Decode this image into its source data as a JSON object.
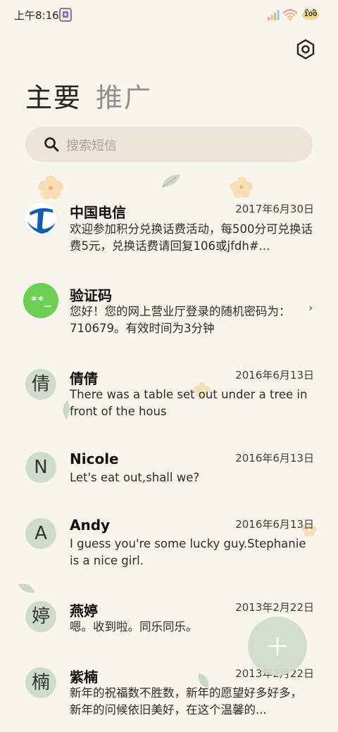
{
  "status_bar": {
    "time": "上午8:16",
    "battery": "100"
  },
  "header": {
    "settings_icon": "hexagon-settings-icon"
  },
  "tabs": [
    {
      "label": "主要",
      "active": true
    },
    {
      "label": "推广",
      "active": false
    }
  ],
  "search": {
    "placeholder": "搜索短信"
  },
  "conversations": [
    {
      "name": "中国电信",
      "date": "2017年6月30日",
      "preview": "欢迎参加积分兑换话费活动，每500分可兑换话费5元，兑换话费请回复106或jfdh#...",
      "avatar": "china-telecom-logo"
    },
    {
      "name": "验证码",
      "date": "",
      "preview": "您好！您的网上营业厅登录的随机密码为：710679。有效时间为3分钟",
      "avatar_text": "**_",
      "chevron": "›"
    },
    {
      "name": "倩倩",
      "date": "2016年6月13日",
      "preview": "There was a table set out under a tree in front of the hous",
      "avatar_text": "倩"
    },
    {
      "name": "Nicole",
      "date": "2016年6月13日",
      "preview": "Let's eat out,shall we?",
      "avatar_text": "N"
    },
    {
      "name": "Andy",
      "date": "2016年6月13日",
      "preview": "I guess you're some lucky guy.Stephanie is a nice girl.",
      "avatar_text": "A"
    },
    {
      "name": "燕婷",
      "date": "2013年2月22日",
      "preview": "嗯。收到啦。同乐同乐。",
      "avatar_text": "婷"
    },
    {
      "name": "紫楠",
      "date": "2013年2月22日",
      "preview": "新年的祝福数不胜数，新年的愿望好多好多，新年的问候依旧美好，在这个温馨的...",
      "avatar_text": "楠"
    }
  ],
  "fab": {
    "icon": "plus-icon"
  },
  "colors": {
    "background": "#f8f5ec",
    "search_bg": "#ede5d9",
    "avatar_bg": "#cfdccb",
    "verify_avatar": "#6bd052",
    "telecom_blue": "#0d5db8"
  }
}
